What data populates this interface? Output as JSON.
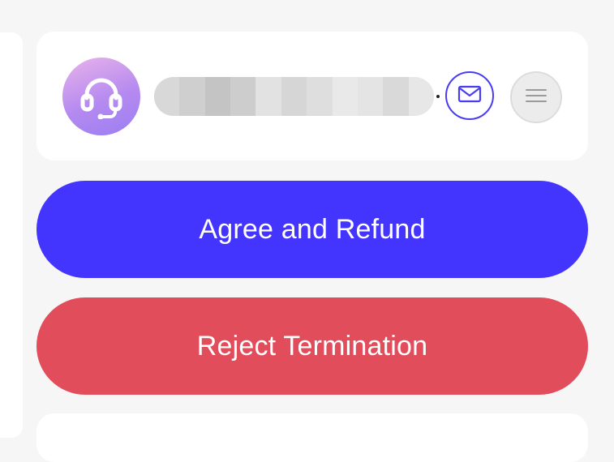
{
  "contact": {
    "avatar_icon": "headset-icon",
    "mail_icon": "envelope-icon",
    "menu_icon": "hamburger-menu-icon"
  },
  "actions": {
    "agree_label": "Agree and Refund",
    "reject_label": "Reject Termination"
  },
  "colors": {
    "primary": "#4435fe",
    "danger": "#e24d5b",
    "avatar_gradient_start": "#e9b3ea",
    "avatar_gradient_end": "#9a7ef2"
  }
}
